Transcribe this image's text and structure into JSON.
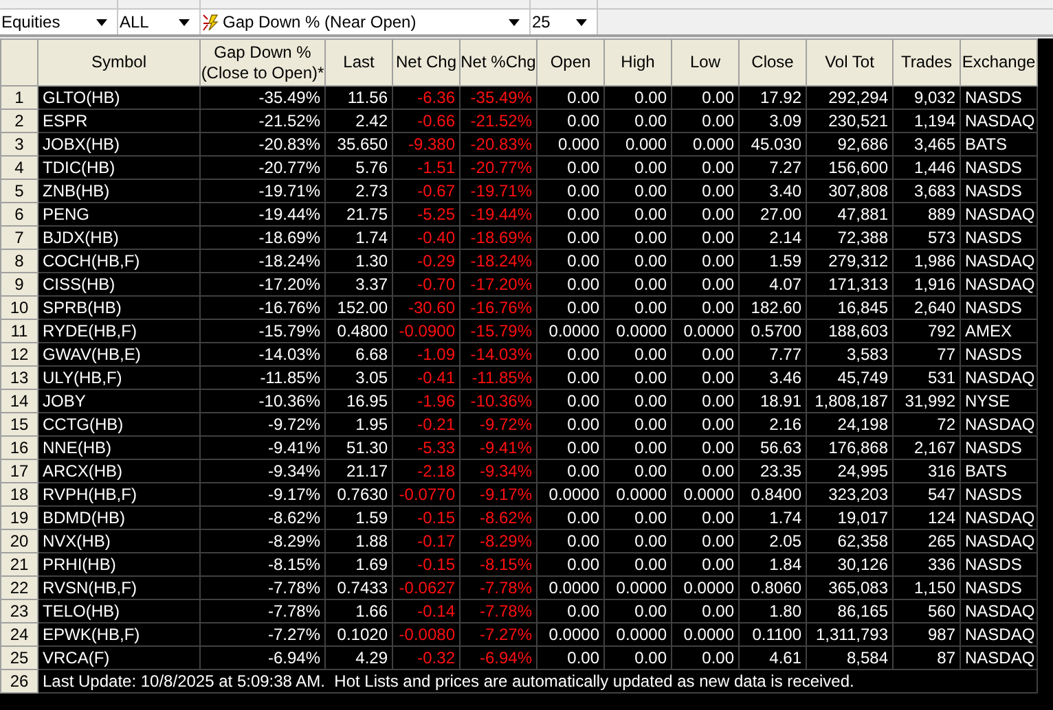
{
  "filters": [
    {
      "value": "Equities"
    },
    {
      "value": "ALL"
    },
    {
      "value": "Gap Down % (Near Open)",
      "icon": true
    },
    {
      "value": "25"
    }
  ],
  "table": {
    "columns": [
      {
        "label": "Symbol",
        "kind": "text"
      },
      {
        "label": "Gap Down %",
        "label2": "(Close to Open)*",
        "kind": "number"
      },
      {
        "label": "Last",
        "kind": "number"
      },
      {
        "label": "Net Chg",
        "kind": "change"
      },
      {
        "label": "Net %Chg",
        "kind": "change"
      },
      {
        "label": "Open",
        "kind": "number"
      },
      {
        "label": "High",
        "kind": "number"
      },
      {
        "label": "Low",
        "kind": "number"
      },
      {
        "label": "Close",
        "kind": "number"
      },
      {
        "label": "Vol Tot",
        "kind": "number"
      },
      {
        "label": "Trades",
        "kind": "number"
      },
      {
        "label": "Exchange",
        "kind": "text"
      }
    ],
    "rows": [
      {
        "num": "1",
        "cells": [
          "GLTO(HB)",
          "-35.49%",
          "11.56",
          "-6.36",
          "-35.49%",
          "0.00",
          "0.00",
          "0.00",
          "17.92",
          "292,294",
          "9,032",
          "NASDS"
        ]
      },
      {
        "num": "2",
        "cells": [
          "ESPR",
          "-21.52%",
          "2.42",
          "-0.66",
          "-21.52%",
          "0.00",
          "0.00",
          "0.00",
          "3.09",
          "230,521",
          "1,194",
          "NASDAQ"
        ]
      },
      {
        "num": "3",
        "cells": [
          "JOBX(HB)",
          "-20.83%",
          "35.650",
          "-9.380",
          "-20.83%",
          "0.000",
          "0.000",
          "0.000",
          "45.030",
          "92,686",
          "3,465",
          "BATS"
        ]
      },
      {
        "num": "4",
        "cells": [
          "TDIC(HB)",
          "-20.77%",
          "5.76",
          "-1.51",
          "-20.77%",
          "0.00",
          "0.00",
          "0.00",
          "7.27",
          "156,600",
          "1,446",
          "NASDS"
        ]
      },
      {
        "num": "5",
        "cells": [
          "ZNB(HB)",
          "-19.71%",
          "2.73",
          "-0.67",
          "-19.71%",
          "0.00",
          "0.00",
          "0.00",
          "3.40",
          "307,808",
          "3,683",
          "NASDS"
        ]
      },
      {
        "num": "6",
        "cells": [
          "PENG",
          "-19.44%",
          "21.75",
          "-5.25",
          "-19.44%",
          "0.00",
          "0.00",
          "0.00",
          "27.00",
          "47,881",
          "889",
          "NASDAQ"
        ]
      },
      {
        "num": "7",
        "cells": [
          "BJDX(HB)",
          "-18.69%",
          "1.74",
          "-0.40",
          "-18.69%",
          "0.00",
          "0.00",
          "0.00",
          "2.14",
          "72,388",
          "573",
          "NASDS"
        ]
      },
      {
        "num": "8",
        "cells": [
          "COCH(HB,F)",
          "-18.24%",
          "1.30",
          "-0.29",
          "-18.24%",
          "0.00",
          "0.00",
          "0.00",
          "1.59",
          "279,312",
          "1,986",
          "NASDAQ"
        ]
      },
      {
        "num": "9",
        "cells": [
          "CISS(HB)",
          "-17.20%",
          "3.37",
          "-0.70",
          "-17.20%",
          "0.00",
          "0.00",
          "0.00",
          "4.07",
          "171,313",
          "1,916",
          "NASDAQ"
        ]
      },
      {
        "num": "10",
        "cells": [
          "SPRB(HB)",
          "-16.76%",
          "152.00",
          "-30.60",
          "-16.76%",
          "0.00",
          "0.00",
          "0.00",
          "182.60",
          "16,845",
          "2,640",
          "NASDS"
        ]
      },
      {
        "num": "11",
        "cells": [
          "RYDE(HB,F)",
          "-15.79%",
          "0.4800",
          "-0.0900",
          "-15.79%",
          "0.0000",
          "0.0000",
          "0.0000",
          "0.5700",
          "188,603",
          "792",
          "AMEX"
        ]
      },
      {
        "num": "12",
        "cells": [
          "GWAV(HB,E)",
          "-14.03%",
          "6.68",
          "-1.09",
          "-14.03%",
          "0.00",
          "0.00",
          "0.00",
          "7.77",
          "3,583",
          "77",
          "NASDS"
        ]
      },
      {
        "num": "13",
        "cells": [
          "ULY(HB,F)",
          "-11.85%",
          "3.05",
          "-0.41",
          "-11.85%",
          "0.00",
          "0.00",
          "0.00",
          "3.46",
          "45,749",
          "531",
          "NASDAQ"
        ]
      },
      {
        "num": "14",
        "cells": [
          "JOBY",
          "-10.36%",
          "16.95",
          "-1.96",
          "-10.36%",
          "0.00",
          "0.00",
          "0.00",
          "18.91",
          "1,808,187",
          "31,992",
          "NYSE"
        ]
      },
      {
        "num": "15",
        "cells": [
          "CCTG(HB)",
          "-9.72%",
          "1.95",
          "-0.21",
          "-9.72%",
          "0.00",
          "0.00",
          "0.00",
          "2.16",
          "24,198",
          "72",
          "NASDAQ"
        ]
      },
      {
        "num": "16",
        "cells": [
          "NNE(HB)",
          "-9.41%",
          "51.30",
          "-5.33",
          "-9.41%",
          "0.00",
          "0.00",
          "0.00",
          "56.63",
          "176,868",
          "2,167",
          "NASDS"
        ]
      },
      {
        "num": "17",
        "cells": [
          "ARCX(HB)",
          "-9.34%",
          "21.17",
          "-2.18",
          "-9.34%",
          "0.00",
          "0.00",
          "0.00",
          "23.35",
          "24,995",
          "316",
          "BATS"
        ]
      },
      {
        "num": "18",
        "cells": [
          "RVPH(HB,F)",
          "-9.17%",
          "0.7630",
          "-0.0770",
          "-9.17%",
          "0.0000",
          "0.0000",
          "0.0000",
          "0.8400",
          "323,203",
          "547",
          "NASDS"
        ]
      },
      {
        "num": "19",
        "cells": [
          "BDMD(HB)",
          "-8.62%",
          "1.59",
          "-0.15",
          "-8.62%",
          "0.00",
          "0.00",
          "0.00",
          "1.74",
          "19,017",
          "124",
          "NASDAQ"
        ]
      },
      {
        "num": "20",
        "cells": [
          "NVX(HB)",
          "-8.29%",
          "1.88",
          "-0.17",
          "-8.29%",
          "0.00",
          "0.00",
          "0.00",
          "2.05",
          "62,358",
          "265",
          "NASDAQ"
        ]
      },
      {
        "num": "21",
        "cells": [
          "PRHI(HB)",
          "-8.15%",
          "1.69",
          "-0.15",
          "-8.15%",
          "0.00",
          "0.00",
          "0.00",
          "1.84",
          "30,126",
          "336",
          "NASDS"
        ]
      },
      {
        "num": "22",
        "cells": [
          "RVSN(HB,F)",
          "-7.78%",
          "0.7433",
          "-0.0627",
          "-7.78%",
          "0.0000",
          "0.0000",
          "0.0000",
          "0.8060",
          "365,083",
          "1,150",
          "NASDS"
        ]
      },
      {
        "num": "23",
        "cells": [
          "TELO(HB)",
          "-7.78%",
          "1.66",
          "-0.14",
          "-7.78%",
          "0.00",
          "0.00",
          "0.00",
          "1.80",
          "86,165",
          "560",
          "NASDAQ"
        ]
      },
      {
        "num": "24",
        "cells": [
          "EPWK(HB,F)",
          "-7.27%",
          "0.1020",
          "-0.0080",
          "-7.27%",
          "0.0000",
          "0.0000",
          "0.0000",
          "0.1100",
          "1,311,793",
          "987",
          "NASDAQ"
        ]
      },
      {
        "num": "25",
        "cells": [
          "VRCA(F)",
          "-6.94%",
          "4.29",
          "-0.32",
          "-6.94%",
          "0.00",
          "0.00",
          "0.00",
          "4.61",
          "8,584",
          "87",
          "NASDAQ"
        ]
      }
    ],
    "footer": {
      "num": "26",
      "text": "Last Update: 10/8/2025 at 5:09:38 AM.  Hot Lists and prices are automatically updated as new data is received."
    }
  }
}
